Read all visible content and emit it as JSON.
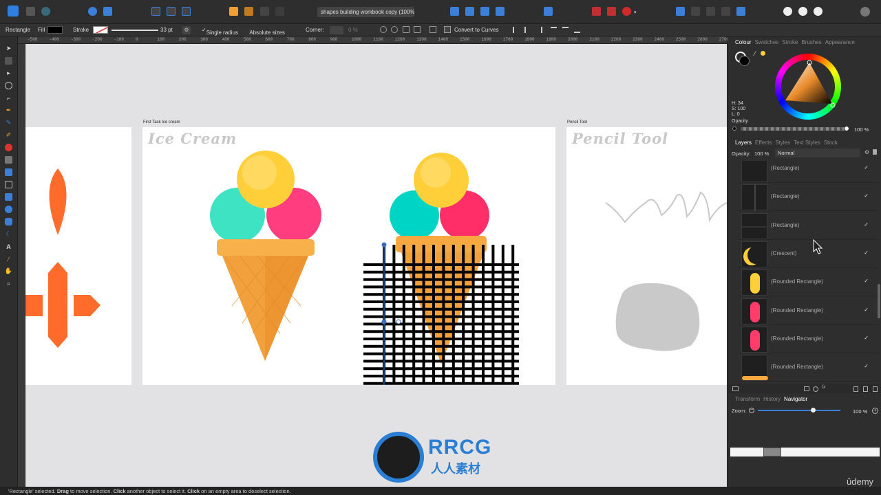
{
  "doc_title": "shapes building workbook copy (100%)",
  "context": {
    "tool": "Rectangle",
    "fill_label": "Fill",
    "stroke_label": "Stroke",
    "stroke_width": "33 pt",
    "single_radius": "Single radius",
    "absolute_sizes": "Absolute sizes",
    "corner_label": "Corner:",
    "corner_value": "0 %",
    "convert": "Convert to Curves"
  },
  "ruler_ticks": [
    "-500",
    "-400",
    "-300",
    "-200",
    "-100",
    "0",
    "100",
    "200",
    "300",
    "400",
    "500",
    "600",
    "700",
    "800",
    "900",
    "1000",
    "1100",
    "1200",
    "1300",
    "1400",
    "1500",
    "1600",
    "1700",
    "1800",
    "1900",
    "2000",
    "2100",
    "2200",
    "2300",
    "2400",
    "2500",
    "2600",
    "2700"
  ],
  "artboards": {
    "ice_label": "First Task Ice cream",
    "ice_title": "Ice Cream",
    "pencil_label": "Pencil Tool",
    "pencil_title": "Pencil Tool"
  },
  "panel": {
    "top_tabs": [
      "Colour",
      "Swatches",
      "Stroke",
      "Brushes",
      "Appearance"
    ],
    "hsl": {
      "h": "H: 34",
      "s": "S: 100",
      "l": "L: 0"
    },
    "opacity_label": "Opacity",
    "opacity_value": "100 %",
    "layer_tabs": [
      "Layers",
      "Effects",
      "Styles",
      "Text Styles",
      "Stock"
    ],
    "layer_opacity_label": "Opacity:",
    "layer_opacity_value": "100 %",
    "blend_mode": "Normal",
    "layers": [
      {
        "name": "(Rectangle)"
      },
      {
        "name": "(Rectangle)"
      },
      {
        "name": "(Rectangle)"
      },
      {
        "name": "(Crescent)"
      },
      {
        "name": "(Rounded Rectangle)"
      },
      {
        "name": "(Rounded Rectangle)"
      },
      {
        "name": "(Rounded Rectangle)"
      },
      {
        "name": "(Rounded Rectangle)"
      }
    ],
    "check": "✓",
    "bottom_tabs": [
      "Transform",
      "History",
      "Navigator"
    ],
    "zoom_label": "Zoom:",
    "zoom_value": "100 %"
  },
  "watermark": {
    "brand": "RRCG",
    "sub": "人人素材"
  },
  "udemy": "ûdemy",
  "status": {
    "selected": "'Rectangle' selected.",
    "drag": "Drag",
    "t1": "to move selection.",
    "click1": "Click",
    "t2": "another object to select it.",
    "click2": "Click",
    "t3": "on an empty area to deselect selection."
  },
  "colors": {
    "accent": "#3b7fd9",
    "orange": "#ff6b2b",
    "cone": "#f2a03c",
    "mint": "#3ee3c3",
    "pink": "#ff3d7f",
    "yellow": "#ffcf3a"
  }
}
